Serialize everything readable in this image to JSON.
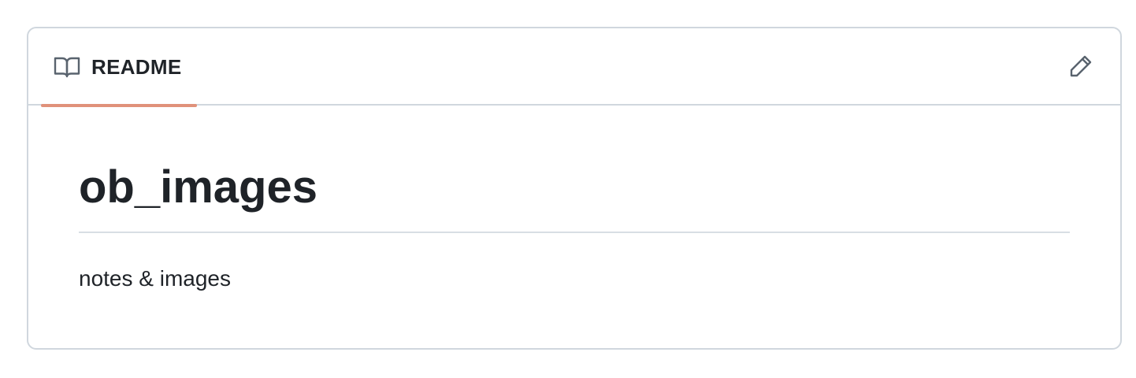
{
  "readme": {
    "tab_label": "README",
    "tab_icon": "book-icon",
    "edit_icon": "pencil-icon",
    "title": "ob_images",
    "description": "notes & images"
  },
  "colors": {
    "border": "#d0d7de",
    "tab_underline": "#e0917a",
    "text": "#1f2328",
    "icon": "#59636e"
  }
}
